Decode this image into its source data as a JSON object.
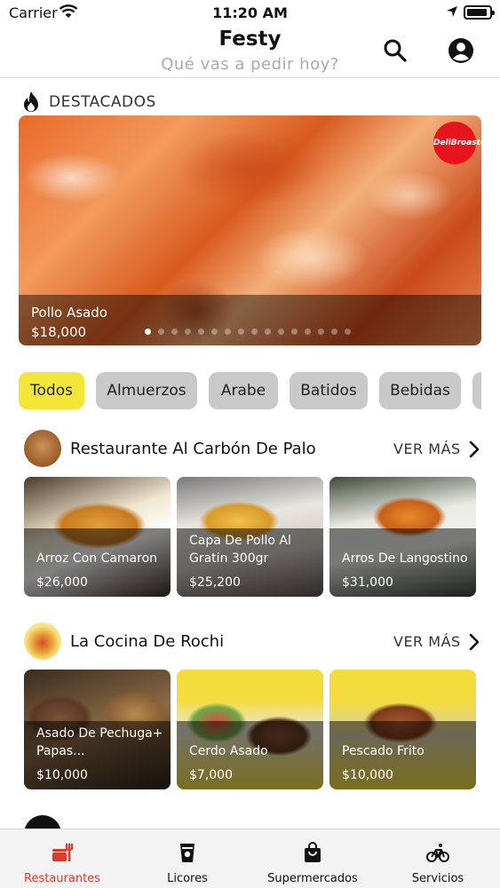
{
  "status_bar": {
    "carrier": "Carrier",
    "time": "11:20 AM"
  },
  "header": {
    "title": "Festy",
    "subtitle": "Qué vas a pedir hoy?"
  },
  "featured": {
    "label": "DESTACADOS",
    "item_name": "Pollo Asado",
    "item_price": "$18,000",
    "logo_text": "DeliBroaster",
    "dots_total": 16,
    "active_dot": 0
  },
  "categories": [
    {
      "label": "Todos",
      "active": true
    },
    {
      "label": "Almuerzos",
      "active": false
    },
    {
      "label": "Arabe",
      "active": false
    },
    {
      "label": "Batidos",
      "active": false
    },
    {
      "label": "Bebidas",
      "active": false
    }
  ],
  "sections": [
    {
      "name": "Restaurante Al Carbón De Palo",
      "more_label": "VER MÁS",
      "items": [
        {
          "name": "Arroz Con Camaron",
          "price": "$26,000"
        },
        {
          "name": "Capa De Pollo Al Gratin 300gr",
          "price": "$25,200"
        },
        {
          "name": "Arros De Langostino",
          "price": "$31,000"
        }
      ]
    },
    {
      "name": "La Cocina De Rochi",
      "more_label": "VER MÁS",
      "items": [
        {
          "name": "Asado De Pechuga+ Papas...",
          "price": "$10,000"
        },
        {
          "name": "Cerdo Asado",
          "price": "$7,000"
        },
        {
          "name": "Pescado Frito",
          "price": "$10,000"
        }
      ]
    }
  ],
  "tabs": [
    {
      "label": "Restaurantes",
      "icon": "restaurant-icon",
      "active": true
    },
    {
      "label": "Licores",
      "icon": "glass-icon",
      "active": false
    },
    {
      "label": "Supermercados",
      "icon": "shopping-bag-icon",
      "active": false
    },
    {
      "label": "Servicios",
      "icon": "bicycle-icon",
      "active": false
    }
  ],
  "colors": {
    "accent": "#e5362b",
    "chip_active": "#f4e637",
    "chip": "#c9c9c9"
  }
}
